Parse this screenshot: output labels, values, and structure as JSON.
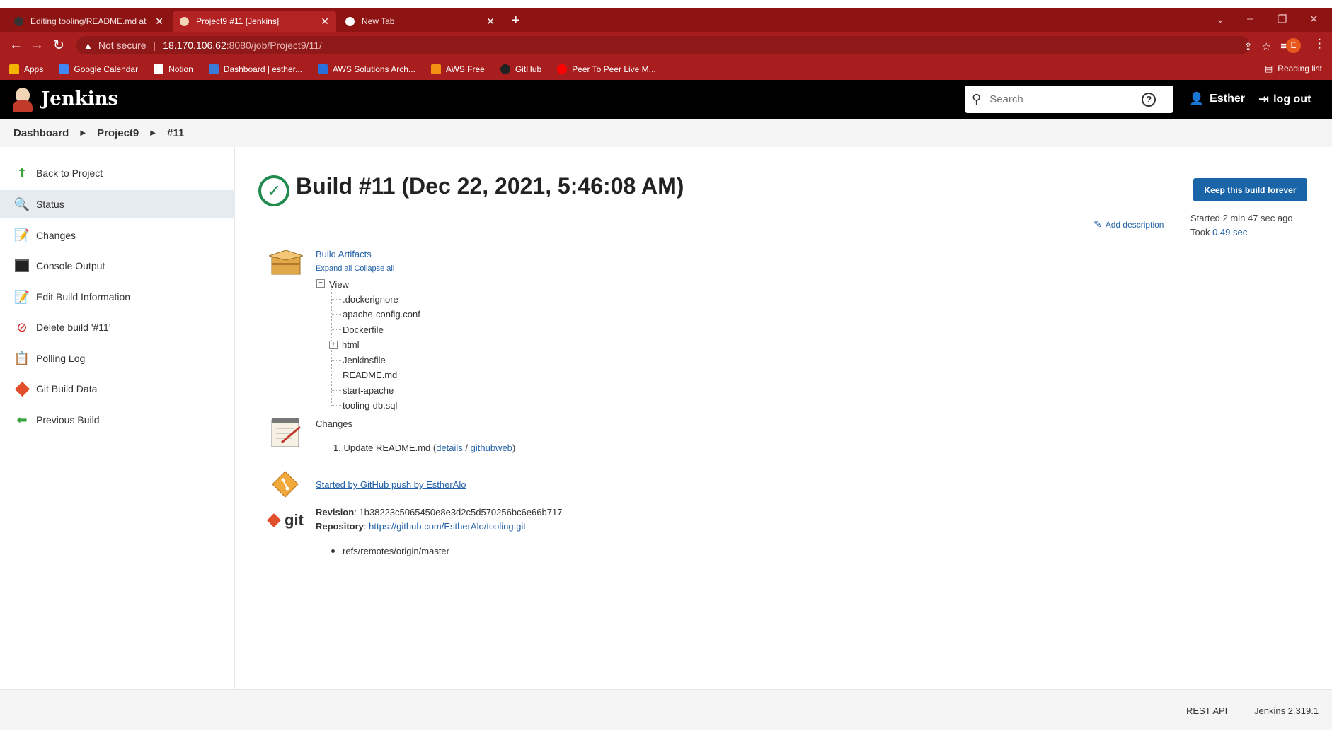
{
  "browser": {
    "tabs": [
      {
        "title": "Editing tooling/README.md at m",
        "active": false
      },
      {
        "title": "Project9 #11 [Jenkins]",
        "active": true
      },
      {
        "title": "New Tab",
        "active": false
      }
    ],
    "security_label": "Not secure",
    "url_host": "18.170.106.62",
    "url_path": ":8080/job/Project9/11/",
    "profile_initial": "E",
    "bookmarks": [
      {
        "label": "Apps",
        "color": "#f4b400"
      },
      {
        "label": "Google Calendar",
        "color": "#4285f4"
      },
      {
        "label": "Notion",
        "color": "#ffffff"
      },
      {
        "label": "Dashboard | esther...",
        "color": "#3b7bd8"
      },
      {
        "label": "AWS Solutions Arch...",
        "color": "#2a6fdb"
      },
      {
        "label": "AWS Free",
        "color": "#f29111"
      },
      {
        "label": "GitHub",
        "color": "#222222"
      },
      {
        "label": "Peer To Peer Live M...",
        "color": "#ff0000"
      }
    ],
    "reading_list": "Reading list"
  },
  "header": {
    "logo_text": "Jenkins",
    "search_placeholder": "Search",
    "user_name": "Esther",
    "logout_label": "log out"
  },
  "breadcrumb": [
    "Dashboard",
    "Project9",
    "#11"
  ],
  "sidebar": {
    "items": [
      {
        "label": "Back to Project",
        "icon": "up-arrow-icon",
        "active": false
      },
      {
        "label": "Status",
        "icon": "magnifier-icon",
        "active": true
      },
      {
        "label": "Changes",
        "icon": "notepad-icon",
        "active": false
      },
      {
        "label": "Console Output",
        "icon": "terminal-icon",
        "active": false
      },
      {
        "label": "Edit Build Information",
        "icon": "notepad-icon",
        "active": false
      },
      {
        "label": "Delete build '#11'",
        "icon": "no-entry-icon",
        "active": false
      },
      {
        "label": "Polling Log",
        "icon": "clipboard-icon",
        "active": false
      },
      {
        "label": "Git Build Data",
        "icon": "git-icon",
        "active": false
      },
      {
        "label": "Previous Build",
        "icon": "left-arrow-icon",
        "active": false
      }
    ]
  },
  "build": {
    "title": "Build #11 (Dec 22, 2021, 5:46:08 AM)",
    "keep_button": "Keep this build forever",
    "add_description": "Add description",
    "started": "Started 2 min 47 sec ago",
    "took_prefix": "Took ",
    "took_value": "0.49 sec",
    "status_color": "#1e8a4c"
  },
  "artifacts": {
    "title": "Build Artifacts",
    "expand_all": "Expand all",
    "collapse_all": "Collapse all",
    "root": "View",
    "files": [
      ".dockerignore",
      "apache-config.conf",
      "Dockerfile",
      "html",
      "Jenkinsfile",
      "README.md",
      "start-apache",
      "tooling-db.sql"
    ]
  },
  "changes": {
    "title": "Changes",
    "item_prefix": "1. Update README.md (",
    "details": "details",
    "separator": " / ",
    "githubweb": "githubweb",
    "item_suffix": ")"
  },
  "cause": {
    "text": "Started by GitHub push by EstherAlo"
  },
  "git": {
    "logo_text": "git",
    "revision_label": "Revision",
    "revision_value": ": 1b38223c5065450e8e3d2c5d570256bc6e66b717",
    "repo_label": "Repository",
    "repo_sep": ": ",
    "repo_url": "https://github.com/EstherAlo/tooling.git",
    "branches": [
      "refs/remotes/origin/master"
    ]
  },
  "footer": {
    "rest_api": "REST API",
    "version": "Jenkins 2.319.1"
  }
}
